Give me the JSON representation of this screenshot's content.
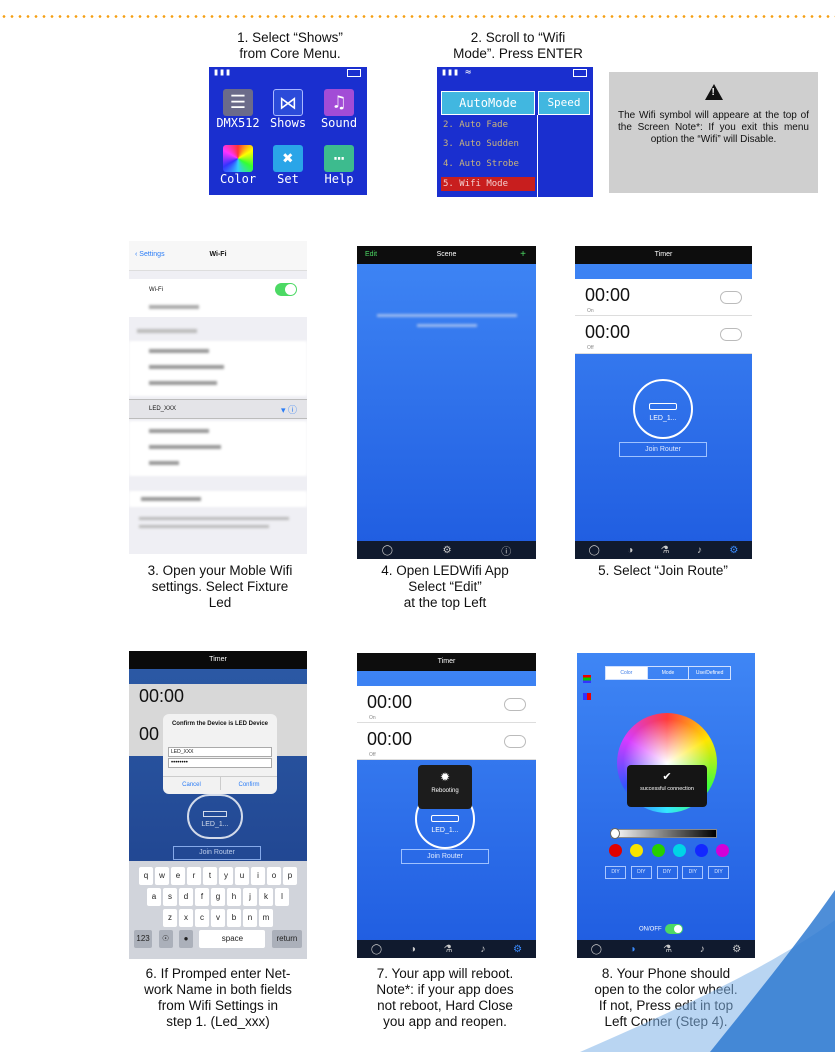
{
  "steps": {
    "s1": {
      "l1": "1. Select “Shows”",
      "l2": "from Core Menu."
    },
    "s2": {
      "l1": "2. Scroll to “Wifi",
      "l2": "Mode”. Press ENTER"
    },
    "s3": {
      "l1": "3. Open your Moble Wifi",
      "l2": "settings. Select Fixture",
      "l3": "Led"
    },
    "s4": {
      "l1": "4. Open LEDWifi App",
      "l2": "Select “Edit”",
      "l3": "at the top Left"
    },
    "s5": {
      "l1": "5. Select “Join Route”"
    },
    "s6": {
      "l1": "6. If Promped enter Net-",
      "l2": "work Name in both fields",
      "l3": "from Wifi Settings in",
      "l4": "step 1. (Led_xxx)"
    },
    "s7": {
      "l1": "7. Your app will reboot.",
      "l2": "Note*: if your app does",
      "l3": "not reboot, Hard Close",
      "l4": "you app and reopen."
    },
    "s8": {
      "l1": "8. Your Phone should",
      "l2": "open to the color wheel.",
      "l3": "If not, Press edit in top",
      "l4": "Left Corner (Step 4)."
    }
  },
  "warning": {
    "symbol": "!",
    "text": "The Wifi symbol will appeare at the top of the Screen Note*: If you exit this menu option the “Wifi” will Disable."
  },
  "core_menu": {
    "items": [
      "DMX512",
      "Shows",
      "Sound",
      "Color",
      "Set",
      "Help"
    ],
    "icon_names": [
      "sliders-icon",
      "shows-icon",
      "music-note-icon",
      "color-wheel-icon",
      "tools-icon",
      "help-chat-icon"
    ]
  },
  "wifi_menu": {
    "header_left": "AutoMode",
    "header_right": "Speed",
    "items": [
      "2. Auto Fade",
      "3. Auto Sudden",
      "4. Auto Strobe",
      "5. Wifi Mode"
    ]
  },
  "screens": {
    "settings": {
      "back": "Settings",
      "title": "Wi-Fi",
      "wifi_label": "Wi-Fi",
      "network": "LED_XXX"
    },
    "scene": {
      "edit": "Edit",
      "title": "Scene",
      "plus": "+"
    },
    "timer": {
      "title": "Timer",
      "time1": "00:00",
      "label1": "On",
      "time2": "00:00",
      "label2": "Off",
      "router_label": "LED_1...",
      "join_button": "Join Router"
    },
    "confirm": {
      "title": "Timer",
      "time1": "00:00",
      "time2": "00",
      "dialog_title": "Confirm the Device is LED Device",
      "field1": "LED_XXX",
      "field2": "••••••••",
      "cancel": "Cancel",
      "confirm": "Confirm",
      "router_label": "LED_1...",
      "join_button": "Join Router",
      "keyboard_rows": [
        "qwertyuiop",
        "asdfghjkl",
        "zxcvbnm"
      ],
      "space": "space",
      "return": "return",
      "num": "123"
    },
    "reboot": {
      "title": "Timer",
      "time1": "00:00",
      "label1": "On",
      "time2": "00:00",
      "label2": "Off",
      "toast": "Rebooting",
      "router_label": "LED_1...",
      "join_button": "Join Router"
    },
    "color": {
      "tabs": [
        "Color",
        "Mode",
        "Use/Defined"
      ],
      "toast": "successful connection",
      "diy_buttons": [
        "DIY",
        "DIY",
        "DIY",
        "DIY",
        "DIY"
      ],
      "onoff": "ON/OFF",
      "swatches": [
        "#e00000",
        "#f7e400",
        "#26d000",
        "#00d5e6",
        "#1328ff",
        "#d200d8"
      ]
    }
  }
}
